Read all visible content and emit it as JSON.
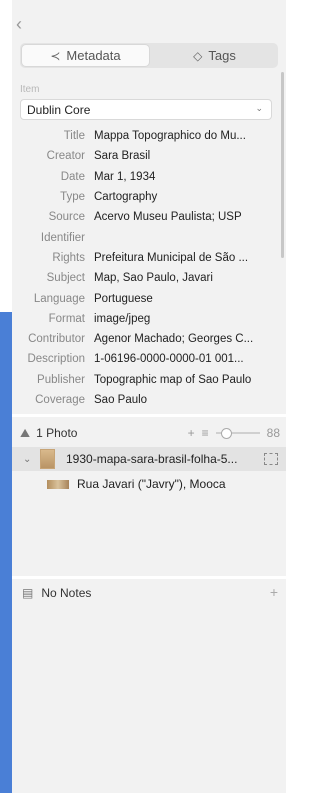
{
  "nav": {
    "back_icon": "chevron-left-icon",
    "back_glyph": "‹"
  },
  "tabs": [
    {
      "label": "Metadata",
      "icon": "share-nodes-icon",
      "glyph": "≺",
      "active": true
    },
    {
      "label": "Tags",
      "icon": "tag-icon",
      "glyph": "◇",
      "active": false
    }
  ],
  "item": {
    "section_label": "Item",
    "schema_select": "Dublin Core"
  },
  "metadata": [
    {
      "key": "Title",
      "value": "Mappa Topographico do Mu..."
    },
    {
      "key": "Creator",
      "value": "Sara Brasil"
    },
    {
      "key": "Date",
      "value": "Mar 1, 1934"
    },
    {
      "key": "Type",
      "value": "Cartography"
    },
    {
      "key": "Source",
      "value": "Acervo Museu Paulista; USP"
    },
    {
      "key": "Identifier",
      "value": ""
    },
    {
      "key": "Rights",
      "value": "Prefeitura Municipal de São ..."
    },
    {
      "key": "Subject",
      "value": "Map, Sao Paulo, Javari"
    },
    {
      "key": "Language",
      "value": "Portuguese"
    },
    {
      "key": "Format",
      "value": "image/jpeg"
    },
    {
      "key": "Contributor",
      "value": "Agenor Machado; Georges C..."
    },
    {
      "key": "Description",
      "value": "1-06196-0000-0000-01 001..."
    },
    {
      "key": "Publisher",
      "value": "Topographic map of Sao Paulo"
    },
    {
      "key": "Coverage",
      "value": "Sao Paulo"
    }
  ],
  "photos": {
    "count_label": "1 Photo",
    "add_glyph": "+",
    "list_glyph": "≡",
    "grid_glyph": "88",
    "zoom_level": 0.15,
    "items": [
      {
        "name": "1930-mapa-sara-brasil-folha-5...",
        "expanded": true,
        "children": [
          {
            "name": "Rua Javari (\"Javry\"), Mooca"
          }
        ]
      }
    ]
  },
  "notes": {
    "label": "No Notes",
    "add_glyph": "+"
  },
  "colors": {
    "accent_strip": "#4a7fd6",
    "panel_bg": "#f2f2f2",
    "selected_row": "#e3e3e3"
  }
}
